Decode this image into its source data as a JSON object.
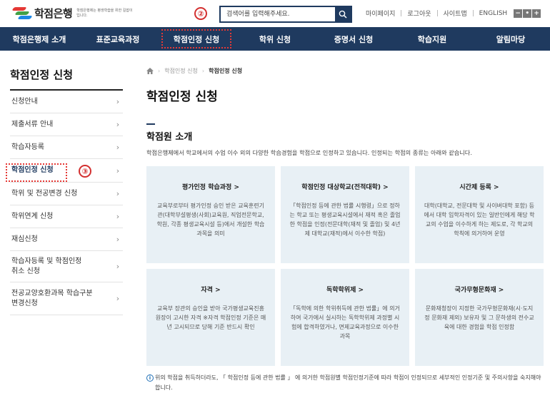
{
  "header": {
    "logo_text": "학점은행",
    "logo_sub": "학점은행제는 평생학습을 위한 길잡이 입니다.",
    "search": {
      "placeholder": "검색어를 입력해주세요."
    },
    "util_links": [
      "마이페이지",
      "로그아웃",
      "사이트맵",
      "ENGLISH"
    ],
    "font_controls": [
      "−",
      "•",
      "+"
    ],
    "callout_top": "②"
  },
  "gnb": [
    "학점은행제 소개",
    "표준교육과정",
    "학점인정 신청",
    "학위 신청",
    "증명서 신청",
    "학습지원",
    "알림마당"
  ],
  "lnb": {
    "title": "학점인정 신청",
    "items": [
      {
        "label": "신청안내",
        "h": 32
      },
      {
        "label": "제출서류 안내",
        "h": 32
      },
      {
        "label": "학습자등록",
        "h": 32
      },
      {
        "label": "학점인정 신청",
        "h": 33
      },
      {
        "label": "학위 및 전공변경 신청",
        "h": 32
      },
      {
        "label": "학위연계 신청",
        "h": 32
      },
      {
        "label": "재심신청",
        "h": 32
      },
      {
        "label": "학습자등록 및 학점인정\n취소 신청",
        "h": 44
      },
      {
        "label": "전공교양호환과목 학습구분\n변경신청",
        "h": 46
      }
    ],
    "callout_side": "③"
  },
  "content": {
    "breadcrumb": [
      "학점인정 신청",
      "학점인정 신청"
    ],
    "page_title": "학점인정 신청",
    "section_title": "학점원 소개",
    "intro": "학점은행제에서 학교에서의 수업 이수 외의 다양한 학습경험을 학점으로 인정하고 있습니다. 인정되는 학점의 종류는 아래와 같습니다.",
    "cards": [
      {
        "title": "평가인정 학습과정 >",
        "desc": "교육부로부터 평가인정 승인 받은 교육훈련기관(대학부설평생(사회)교육원, 직업전문학교, 학원, 각종 평생교육시설 등)에서 개설한 학습과목을 의미"
      },
      {
        "title": "학점인정 대상학교(전적대학) >",
        "desc": "「학점인정 등에 관한 법률 시행령」으로 정하는 학교 또는 평생교육시설에서 재적 혹은 졸업한 학점을 인정(전문대학(재적 및 졸업) 및 4년제 대학교(재적)에서 이수한 학점)"
      },
      {
        "title": "시간제 등록 >",
        "desc": "대학(대학교, 전문대학 및 사이버대학 포함) 등 에서 대학 입학자격이 있는 일반인에게 해당 학교의 수업을 이수하게 하는 제도로, 각 학교의 학칙에 의거하여 운영"
      },
      {
        "title": "자격 >",
        "desc": "교육부 장관의 승인을 받아 국가평생교육진흥원장이 고시한 자격 ※자격 학점인정 기준은 매년 고시되므로 당해 기준 반드시 확인"
      },
      {
        "title": "독학학위제 >",
        "desc": "「독학에 의한 학위취득에 관한 법률」에 의거하여 국가에서 실시하는 독학학위제 과정별 시험에 합격하였거나, 면제교육과정으로 이수한 과목"
      },
      {
        "title": "국가무형문화재 >",
        "desc": "문화재청장이 지정한 국가무형문화재(시·도지정 문화재 제외) 보유자 및 그 문하생의 전수교육에 대한 경험을 학점 인정함"
      }
    ],
    "notice": "위의 학점을 취득하더라도, 「 학점인정 등에 관한 법률 」 에 의거한 학점원별 학점인정기준에 따라 학점이 인정되므로 세부적인 인정기준 및 주의사항을 숙지해야 합니다."
  },
  "colors": {
    "navy": "#1f3a5f",
    "callout_red": "#d32f2f",
    "card_bg": "#e8f0f5"
  },
  "icons": {
    "search": "search-icon",
    "home": "home-icon",
    "info": "info-icon",
    "chevron": "chevron-right-icon"
  }
}
